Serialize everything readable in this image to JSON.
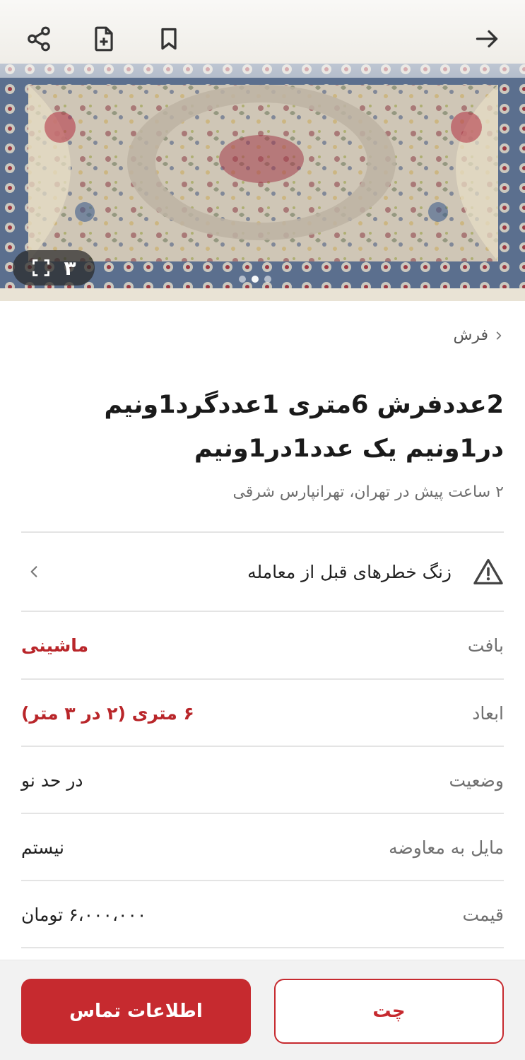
{
  "header": {
    "icons": [
      "share-icon",
      "add-note-icon",
      "bookmark-icon",
      "back-arrow-icon"
    ]
  },
  "gallery": {
    "count": "۳",
    "icon": "fullscreen-icon",
    "total_dots": 3,
    "active_dot": 2
  },
  "breadcrumb": {
    "label": "فرش"
  },
  "listing": {
    "title": "2عددفرش 6متری 1عددگرد1ونیم در1ونیم یک عدد1در1ونیم",
    "subtitle": "۲ ساعت پیش در تهران، تهرانپارس شرقی"
  },
  "warning": {
    "label": "زنگ خطرهای قبل از معامله",
    "icon": "warning-triangle-icon"
  },
  "details": [
    {
      "label": "بافت",
      "value": "ماشینی",
      "highlight": true
    },
    {
      "label": "ابعاد",
      "value": "۶ متری (۲ در ۳ متر)",
      "highlight": true
    },
    {
      "label": "وضعیت",
      "value": "در حد نو",
      "highlight": false
    },
    {
      "label": "مایل به معاوضه",
      "value": "نیستم",
      "highlight": false
    },
    {
      "label": "قیمت",
      "value": "۶،۰۰۰،۰۰۰ تومان",
      "highlight": false
    }
  ],
  "actions": {
    "contact_label": "اطلاعات تماس",
    "chat_label": "چت"
  },
  "colors": {
    "accent": "#c62a2f",
    "highlight_text": "#b9262a"
  }
}
